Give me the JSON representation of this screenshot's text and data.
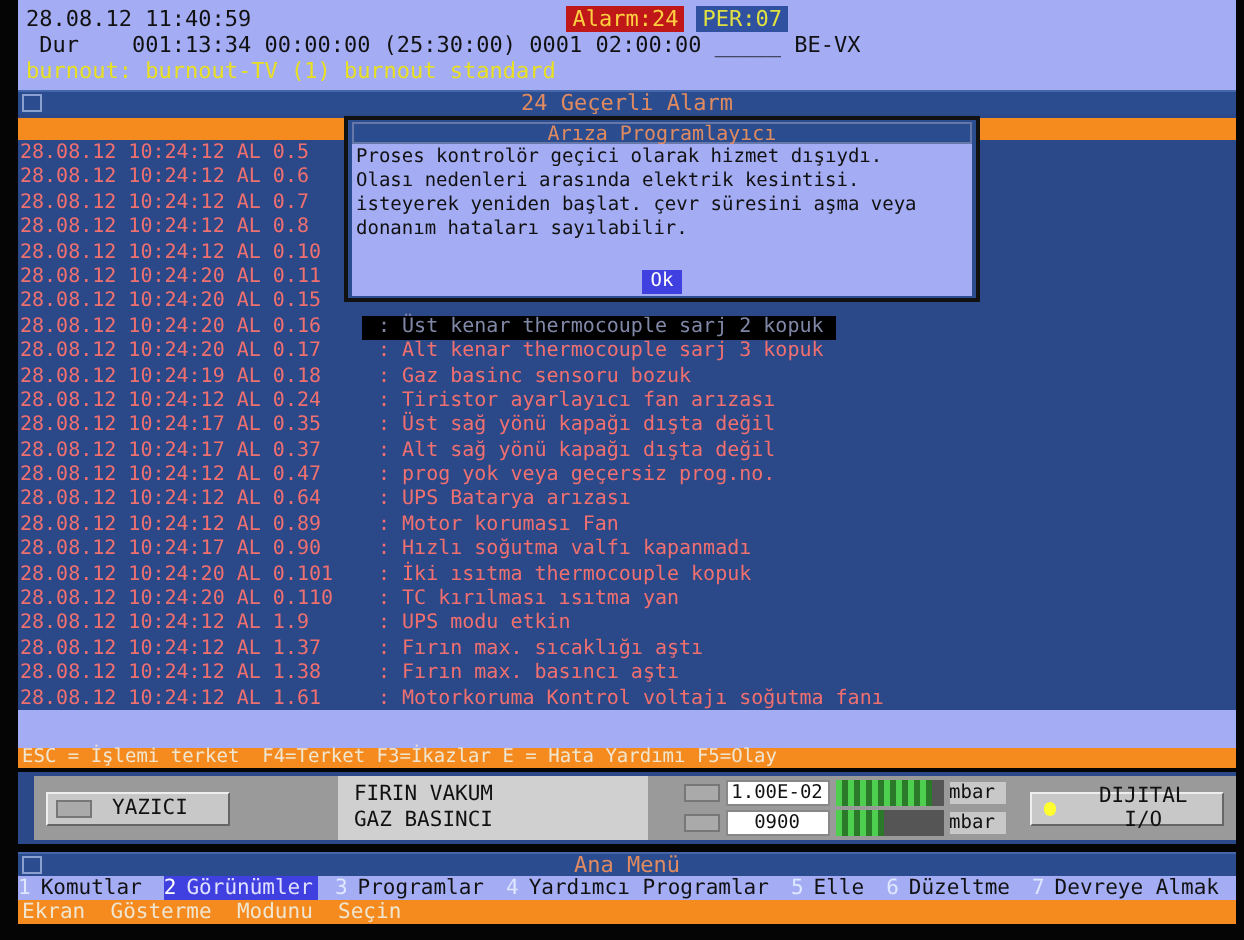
{
  "header": {
    "datetime": "28.08.12 11:40:59",
    "run_line": "Dur    001:13:34 00:00:00 (25:30:00) 0001 02:00:00 _____ BE-VX",
    "program_line": "burnout: burnout-TV (1) burnout standard",
    "alarm_badge": "Alarm:24",
    "per_badge": "PER:07"
  },
  "alarm_panel": {
    "title": "24 Geçerli Alarm",
    "rows": [
      {
        "time": "28.08.12 10:24:12",
        "code": "AL 0.5"
      },
      {
        "time": "28.08.12 10:24:12",
        "code": "AL 0.6"
      },
      {
        "time": "28.08.12 10:24:12",
        "code": "AL 0.7"
      },
      {
        "time": "28.08.12 10:24:12",
        "code": "AL 0.8"
      },
      {
        "time": "28.08.12 10:24:12",
        "code": "AL 0.10"
      },
      {
        "time": "28.08.12 10:24:20",
        "code": "AL 0.11"
      },
      {
        "time": "28.08.12 10:24:20",
        "code": "AL 0.15"
      },
      {
        "time": "28.08.12 10:24:20",
        "code": "AL 0.16",
        "message": ": Üst kenar thermocouple sarj 2 kopuk",
        "shadowed": true
      },
      {
        "time": "28.08.12 10:24:20",
        "code": "AL 0.17",
        "message": ": Alt kenar thermocouple sarj 3 kopuk",
        "shadowed": false
      },
      {
        "time": "28.08.12 10:24:19",
        "code": "AL 0.18",
        "message": ": Gaz basinc sensoru bozuk",
        "shadowed": false
      },
      {
        "time": "28.08.12 10:24:12",
        "code": "AL 0.24",
        "message": ": Tiristor ayarlayıcı fan arızası",
        "shadowed": false
      },
      {
        "time": "28.08.12 10:24:17",
        "code": "AL 0.35",
        "message": ": Üst sağ yönü kapağı dışta değil",
        "shadowed": false
      },
      {
        "time": "28.08.12 10:24:17",
        "code": "AL 0.37",
        "message": ": Alt sağ yönü kapağı dışta değil",
        "shadowed": false
      },
      {
        "time": "28.08.12 10:24:12",
        "code": "AL 0.47",
        "message": ": prog yok veya geçersiz prog.no.",
        "shadowed": false
      },
      {
        "time": "28.08.12 10:24:12",
        "code": "AL 0.64",
        "message": ": UPS Batarya arızası",
        "shadowed": false
      },
      {
        "time": "28.08.12 10:24:12",
        "code": "AL 0.89",
        "message": ": Motor koruması Fan",
        "shadowed": false
      },
      {
        "time": "28.08.12 10:24:17",
        "code": "AL 0.90",
        "message": ": Hızlı soğutma valfı kapanmadı",
        "shadowed": false
      },
      {
        "time": "28.08.12 10:24:20",
        "code": "AL 0.101",
        "message": ": İki ısıtma thermocouple kopuk",
        "shadowed": false
      },
      {
        "time": "28.08.12 10:24:20",
        "code": "AL 0.110",
        "message": ": TC kırılması ısıtma yan",
        "shadowed": false
      },
      {
        "time": "28.08.12 10:24:12",
        "code": "AL 1.9",
        "message": ": UPS modu etkin",
        "shadowed": false
      },
      {
        "time": "28.08.12 10:24:12",
        "code": "AL 1.37",
        "message": ": Fırın max. sıcaklığı aştı",
        "shadowed": false
      },
      {
        "time": "28.08.12 10:24:12",
        "code": "AL 1.38",
        "message": ": Fırın max. basıncı aştı",
        "shadowed": false
      },
      {
        "time": "28.08.12 10:24:12",
        "code": "AL 1.61",
        "message": ": Motorkoruma Kontrol voltajı soğutma fanı",
        "shadowed": false
      }
    ]
  },
  "dialog": {
    "title": "Arıza Programlayıcı",
    "lines": [
      "Proses kontrolör geçici olarak hizmet dışıydı.",
      "Olası nedenleri arasında elektrik kesintisi.",
      "isteyerek yeniden başlat. çevr süresini aşma veya",
      "donanım hataları sayılabilir."
    ],
    "button": "Ok"
  },
  "key_hints": "ESC = İşlemi terket  F4=Terket F3=İkazlar E = Hata Yardımı F5=Olay",
  "gauges": {
    "printer_button": "YAZICI",
    "labels": [
      "FIRIN VAKUM",
      "GAZ BASINCI"
    ],
    "readings": [
      {
        "value": "1.00E-02",
        "unit": "mbar",
        "level": 0.9
      },
      {
        "value": "0900",
        "unit": "mbar",
        "level": 0.45
      }
    ],
    "digital_io_button": "DIJITAL I/O"
  },
  "main_menu": {
    "title": "Ana Menü",
    "items": [
      {
        "number": "1",
        "label": "Komutlar",
        "selected": false
      },
      {
        "number": "2",
        "label": "Görünümler",
        "selected": true
      },
      {
        "number": "3",
        "label": "Programlar",
        "selected": false
      },
      {
        "number": "4",
        "label": "Yardımcı Programlar",
        "selected": false
      },
      {
        "number": "5",
        "label": "Elle",
        "selected": false
      },
      {
        "number": "6",
        "label": "Düzeltme",
        "selected": false
      },
      {
        "number": "7",
        "label": "Devreye Almak",
        "selected": false
      }
    ],
    "prompt": "Ekran  Gösterme  Modunu  Seçin"
  }
}
